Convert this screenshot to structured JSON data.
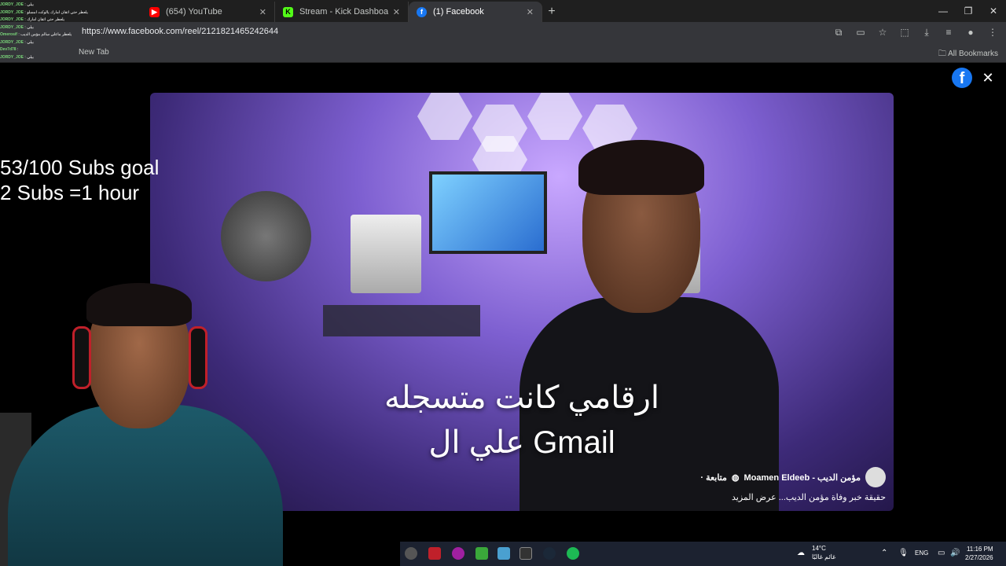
{
  "browser": {
    "tabs": [
      {
        "label": "(654) YouTube",
        "active": false,
        "icon": "youtube-icon",
        "color": "#ff0000"
      },
      {
        "label": "Stream - Kick Dashboard",
        "active": false,
        "icon": "kick-icon",
        "color": "#53fc18"
      },
      {
        "label": "(1) Facebook",
        "active": true,
        "icon": "facebook-icon",
        "color": "#1877f2"
      }
    ],
    "url": "https://www.facebook.com/reel/2121821465242644",
    "bookmarks": {
      "new_tab": "New Tab",
      "all_bookmarks": "All Bookmarks"
    }
  },
  "reel": {
    "subtitle_line1": "ارقامي كانت متسجله",
    "subtitle_line2": "علي ال Gmail",
    "creator": "Moamen Eldeeb - مؤمن الديب",
    "follow": "· متابعة",
    "caption": "حقيقة خبر وفاة مؤمن الديب... عرض المزيد"
  },
  "overlay": {
    "subs_goal": "53/100 Subs goal",
    "subs_rate": "2 Subs =1 hour",
    "chat": [
      {
        "user": "JORDY_JOE",
        "msg": "بيلي"
      },
      {
        "user": "JORDY_JOE",
        "msg": "يلعطر حتي اتقان امارك يالوكت امسلو"
      },
      {
        "user": "JORDY_JOE",
        "msg": "يلعطر حتي اتقان امارك"
      },
      {
        "user": "JORDY_JOE",
        "msg": "بيلي"
      },
      {
        "user": "Omerosif",
        "msg": "يلعطر ماعلي سالم مؤمن الديب"
      },
      {
        "user": "JORDY_JOE",
        "msg": "بيلي"
      },
      {
        "user": "Dev7d78",
        "msg": ""
      },
      {
        "user": "JORDY_JOE",
        "msg": "بيلي"
      }
    ]
  },
  "taskbar": {
    "temperature": "14°C",
    "weather_label": "غائم غالبًا",
    "language": "ENG",
    "time": "11:16 PM",
    "date": "2/27/2026"
  }
}
